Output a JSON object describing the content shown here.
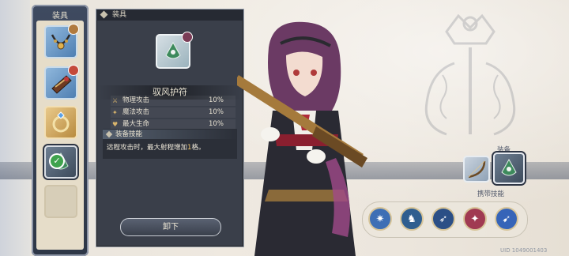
{
  "equipment_panel": {
    "title": "装具",
    "slots": [
      {
        "icon": "necklace-icon"
      },
      {
        "icon": "bracer-icon"
      },
      {
        "icon": "ring-icon"
      },
      {
        "icon": "amulet-icon",
        "selected": true
      },
      {
        "icon": "empty-slot"
      }
    ]
  },
  "detail": {
    "header": "装具",
    "item_name": "驭风护符",
    "stats": [
      {
        "label": "物理攻击",
        "value": "10%"
      },
      {
        "label": "魔法攻击",
        "value": "10%"
      },
      {
        "label": "最大生命",
        "value": "10%"
      }
    ],
    "skill_title": "装备技能",
    "skill_desc_prefix": "远程攻击时，最大射程增加",
    "skill_desc_highlight": "1",
    "skill_desc_suffix": "格。",
    "unequip_label": "卸下"
  },
  "right": {
    "equip_label": "装备",
    "carry_label": "携带技能",
    "uid": "UID 1049001403",
    "skills": [
      {
        "icon": "burst-icon",
        "color": "#3e6fb5"
      },
      {
        "icon": "rider-icon",
        "color": "#2f5e8f"
      },
      {
        "icon": "bow-icon",
        "color": "#2b4f86"
      },
      {
        "icon": "strike-icon",
        "color": "#a03a52"
      },
      {
        "icon": "arrow-icon",
        "color": "#3664b8"
      }
    ]
  },
  "colors": {
    "panel_bg": "#3a3f4a",
    "highlight": "#f0c46a",
    "check": "#3fa34d"
  }
}
